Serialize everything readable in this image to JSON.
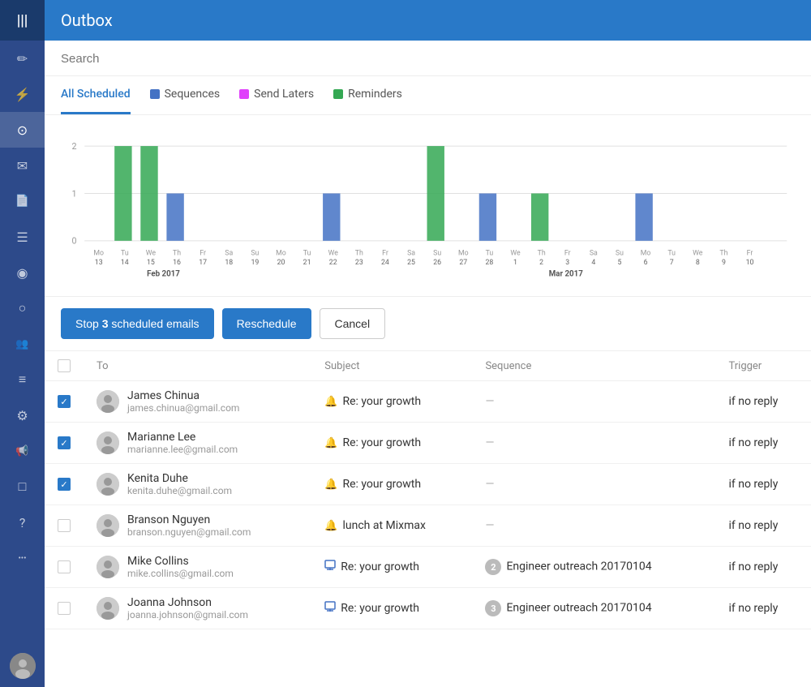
{
  "header": {
    "title": "Outbox"
  },
  "search": {
    "placeholder": "Search"
  },
  "tabs": [
    {
      "id": "all",
      "label": "All Scheduled",
      "active": true,
      "color": null
    },
    {
      "id": "sequences",
      "label": "Sequences",
      "active": false,
      "color": "#4472c4"
    },
    {
      "id": "sendlaters",
      "label": "Send Laters",
      "active": false,
      "color": "#e040fb"
    },
    {
      "id": "reminders",
      "label": "Reminders",
      "active": false,
      "color": "#34a853"
    }
  ],
  "chart": {
    "y_labels": [
      "2",
      "1",
      "0"
    ],
    "x_labels": [
      "13",
      "14",
      "15",
      "16",
      "17",
      "18",
      "19",
      "20",
      "21",
      "22",
      "23",
      "24",
      "25",
      "26",
      "27",
      "28",
      "1",
      "2",
      "3",
      "4",
      "5",
      "6",
      "7",
      "8",
      "9",
      "10"
    ],
    "day_labels": [
      "Mo",
      "Tu",
      "We",
      "Th",
      "Fr",
      "Sa",
      "Su",
      "Mo",
      "Tu",
      "We",
      "Th",
      "Fr",
      "Sa",
      "Su",
      "Mo",
      "Tu",
      "We",
      "Th",
      "Fr",
      "Sa",
      "Su",
      "Mo",
      "Tu",
      "We",
      "Th",
      "Fr"
    ],
    "month_label1": "Feb 2017",
    "month_label2": "Mar 2017"
  },
  "actions": {
    "stop_label": "Stop",
    "stop_count": "3",
    "stop_suffix": "scheduled emails",
    "reschedule_label": "Reschedule",
    "cancel_label": "Cancel"
  },
  "table": {
    "headers": [
      "",
      "To",
      "Subject",
      "Sequence",
      "Trigger"
    ],
    "rows": [
      {
        "checked": true,
        "name": "James Chinua",
        "email": "james.chinua@gmail.com",
        "icon_type": "reminder",
        "subject": "Re: your growth",
        "sequence": "—",
        "seq_badge": null,
        "trigger": "if no reply"
      },
      {
        "checked": true,
        "name": "Marianne Lee",
        "email": "marianne.lee@gmail.com",
        "icon_type": "reminder",
        "subject": "Re: your growth",
        "sequence": "—",
        "seq_badge": null,
        "trigger": "if no reply"
      },
      {
        "checked": true,
        "name": "Kenita Duhe",
        "email": "kenita.duhe@gmail.com",
        "icon_type": "reminder",
        "subject": "Re: your growth",
        "sequence": "—",
        "seq_badge": null,
        "trigger": "if no reply"
      },
      {
        "checked": false,
        "name": "Branson Nguyen",
        "email": "branson.nguyen@gmail.com",
        "icon_type": "reminder",
        "subject": "lunch at Mixmax",
        "sequence": "—",
        "seq_badge": null,
        "trigger": "if no reply"
      },
      {
        "checked": false,
        "name": "Mike Collins",
        "email": "mike.collins@gmail.com",
        "icon_type": "sequence",
        "subject": "Re: your growth",
        "sequence": "Engineer outreach 20170104",
        "seq_badge": "2",
        "trigger": "if no reply"
      },
      {
        "checked": false,
        "name": "Joanna Johnson",
        "email": "joanna.johnson@gmail.com",
        "icon_type": "sequence",
        "subject": "Re: your growth",
        "sequence": "Engineer outreach 20170104",
        "seq_badge": "3",
        "trigger": "if no reply"
      }
    ]
  },
  "sidebar": {
    "logo": "|||",
    "icons": [
      {
        "id": "compose",
        "symbol": "✏",
        "active": false
      },
      {
        "id": "lightning",
        "symbol": "⚡",
        "active": false
      },
      {
        "id": "clock",
        "symbol": "⊙",
        "active": true
      },
      {
        "id": "inbox",
        "symbol": "✉",
        "active": false
      },
      {
        "id": "doc",
        "symbol": "📄",
        "active": false
      },
      {
        "id": "list",
        "symbol": "☰",
        "active": false
      },
      {
        "id": "chart",
        "symbol": "◉",
        "active": false
      },
      {
        "id": "circle",
        "symbol": "○",
        "active": false
      },
      {
        "id": "people",
        "symbol": "👥",
        "active": false
      },
      {
        "id": "lines",
        "symbol": "≡",
        "active": false
      },
      {
        "id": "gear",
        "symbol": "⚙",
        "active": false
      },
      {
        "id": "megaphone",
        "symbol": "📢",
        "active": false
      },
      {
        "id": "box",
        "symbol": "□",
        "active": false
      },
      {
        "id": "question",
        "symbol": "?",
        "active": false
      },
      {
        "id": "dots",
        "symbol": "•••",
        "active": false
      }
    ]
  }
}
